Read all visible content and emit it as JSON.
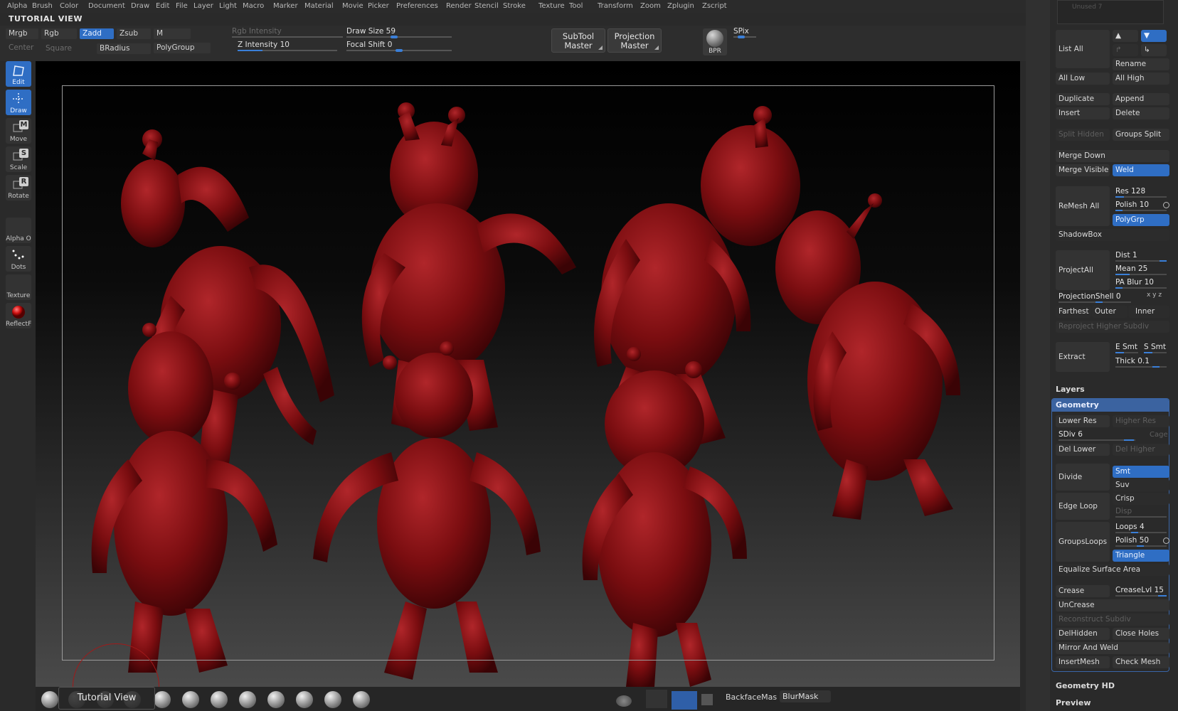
{
  "menu": [
    "Alpha",
    "Brush",
    "Color",
    "Document",
    "Draw",
    "Edit",
    "File",
    "Layer",
    "Light",
    "Macro",
    "Marker",
    "Material",
    "Movie",
    "Picker",
    "Preferences",
    "Render",
    "Stencil",
    "Stroke",
    "Texture",
    "Tool",
    "Transform",
    "Zoom",
    "Zplugin",
    "Zscript"
  ],
  "title": "TUTORIAL VIEW",
  "toolbar": {
    "mrgb": "Mrgb",
    "rgb": "Rgb",
    "zadd": "Zadd",
    "zsub": "Zsub",
    "m": "M",
    "center": "Center",
    "square": "Square",
    "bradius": "BRadius",
    "polygroup": "PolyGroup",
    "rgb_intensity": "Rgb Intensity",
    "z_intensity_label": "Z Intensity",
    "z_intensity_value": "10",
    "z_intensity": 0.25,
    "draw_size_label": "Draw Size",
    "draw_size_value": "59",
    "draw_size": 0.45,
    "focal_shift_label": "Focal Shift",
    "focal_shift_value": "0",
    "focal_shift": 0.5,
    "subtool_master": [
      "SubTool",
      "Master"
    ],
    "projection_master": [
      "Projection",
      "Master"
    ],
    "bpr": "BPR",
    "spix": "SPix"
  },
  "tools": [
    {
      "label": "Edit",
      "active": true,
      "icon": "edit-icon"
    },
    {
      "label": "Draw",
      "active": true,
      "icon": "draw-icon"
    },
    {
      "label": "Move",
      "active": false,
      "icon": "move-icon",
      "key": "M"
    },
    {
      "label": "Scale",
      "active": false,
      "icon": "scale-icon",
      "key": "S"
    },
    {
      "label": "Rotate",
      "active": false,
      "icon": "rotate-icon",
      "key": "R"
    },
    {
      "label": "Alpha",
      "active": false,
      "icon": "alpha-icon",
      "suffix": "O"
    },
    {
      "label": "Dots",
      "active": false,
      "icon": "dots-icon"
    },
    {
      "label": "Texture",
      "active": false,
      "icon": "texture-icon"
    },
    {
      "label": "ReflectF",
      "active": false,
      "icon": "material-sphere-icon"
    }
  ],
  "canvas": {
    "body_color": "#7a0d10",
    "frame_color": "#9a9a9a"
  },
  "bottom": {
    "tooltip": "Tutorial View",
    "backface": "BackfaceMas",
    "blurmask": "BlurMask"
  },
  "right": {
    "unused": "Unused 7",
    "list_all": "List All",
    "rename": "Rename",
    "all_low": "All Low",
    "all_high": "All High",
    "duplicate": "Duplicate",
    "append": "Append",
    "insert": "Insert",
    "delete": "Delete",
    "split_hidden": "Split Hidden",
    "groups_split": "Groups Split",
    "merge_down": "Merge Down",
    "merge_visible": "Merge Visible",
    "weld": "Weld",
    "remesh_all": "ReMesh All",
    "res_label": "Res",
    "res_value": "128",
    "polish_label": "Polish",
    "polish_value": "10",
    "polygrp": "PolyGrp",
    "shadowbox": "ShadowBox",
    "projectall": "ProjectAll",
    "dist_label": "Dist",
    "dist_value": "1",
    "mean_label": "Mean",
    "mean_value": "25",
    "pablur_label": "PA Blur",
    "pablur_value": "10",
    "projshell_label": "ProjectionShell",
    "projshell_value": "0",
    "xyz": "x y z",
    "farthest": "Farthest",
    "outer": "Outer",
    "inner": "Inner",
    "reproject": "Reproject Higher Subdiv",
    "extract": "Extract",
    "esmt": "E Smt",
    "ssmt": "S Smt",
    "thick_label": "Thick",
    "thick_value": "0.1",
    "layers": "Layers",
    "geometry": "Geometry",
    "lower_res": "Lower Res",
    "higher_res": "Higher Res",
    "sdiv_label": "SDiv",
    "sdiv_value": "6",
    "cage": "Cage",
    "del_lower": "Del Lower",
    "del_higher": "Del Higher",
    "divide": "Divide",
    "smt": "Smt",
    "suv": "Suv",
    "edge_loop": "Edge Loop",
    "crisp": "Crisp",
    "disp": "Disp",
    "groupsloops": "GroupsLoops",
    "loops_label": "Loops",
    "loops_value": "4",
    "polish2_label": "Polish",
    "polish2_value": "50",
    "triangle": "Triangle",
    "equalize": "Equalize Surface Area",
    "crease": "Crease",
    "creaselvl_label": "CreaseLvl",
    "creaselvl_value": "15",
    "uncrease": "UnCrease",
    "reconstruct": "Reconstruct Subdiv",
    "delhidden": "DelHidden",
    "close_holes": "Close Holes",
    "mirror_weld": "Mirror And Weld",
    "insertmesh": "InsertMesh",
    "check_mesh": "Check Mesh",
    "geometry_hd": "Geometry HD",
    "preview": "Preview"
  }
}
